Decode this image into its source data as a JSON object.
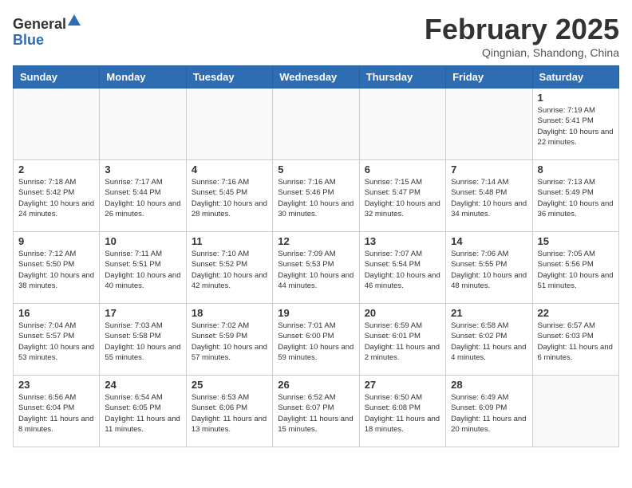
{
  "header": {
    "logo_general": "General",
    "logo_blue": "Blue",
    "month_title": "February 2025",
    "location": "Qingnian, Shandong, China"
  },
  "weekdays": [
    "Sunday",
    "Monday",
    "Tuesday",
    "Wednesday",
    "Thursday",
    "Friday",
    "Saturday"
  ],
  "weeks": [
    [
      {
        "day": "",
        "info": ""
      },
      {
        "day": "",
        "info": ""
      },
      {
        "day": "",
        "info": ""
      },
      {
        "day": "",
        "info": ""
      },
      {
        "day": "",
        "info": ""
      },
      {
        "day": "",
        "info": ""
      },
      {
        "day": "1",
        "info": "Sunrise: 7:19 AM\nSunset: 5:41 PM\nDaylight: 10 hours\nand 22 minutes."
      }
    ],
    [
      {
        "day": "2",
        "info": "Sunrise: 7:18 AM\nSunset: 5:42 PM\nDaylight: 10 hours\nand 24 minutes."
      },
      {
        "day": "3",
        "info": "Sunrise: 7:17 AM\nSunset: 5:44 PM\nDaylight: 10 hours\nand 26 minutes."
      },
      {
        "day": "4",
        "info": "Sunrise: 7:16 AM\nSunset: 5:45 PM\nDaylight: 10 hours\nand 28 minutes."
      },
      {
        "day": "5",
        "info": "Sunrise: 7:16 AM\nSunset: 5:46 PM\nDaylight: 10 hours\nand 30 minutes."
      },
      {
        "day": "6",
        "info": "Sunrise: 7:15 AM\nSunset: 5:47 PM\nDaylight: 10 hours\nand 32 minutes."
      },
      {
        "day": "7",
        "info": "Sunrise: 7:14 AM\nSunset: 5:48 PM\nDaylight: 10 hours\nand 34 minutes."
      },
      {
        "day": "8",
        "info": "Sunrise: 7:13 AM\nSunset: 5:49 PM\nDaylight: 10 hours\nand 36 minutes."
      }
    ],
    [
      {
        "day": "9",
        "info": "Sunrise: 7:12 AM\nSunset: 5:50 PM\nDaylight: 10 hours\nand 38 minutes."
      },
      {
        "day": "10",
        "info": "Sunrise: 7:11 AM\nSunset: 5:51 PM\nDaylight: 10 hours\nand 40 minutes."
      },
      {
        "day": "11",
        "info": "Sunrise: 7:10 AM\nSunset: 5:52 PM\nDaylight: 10 hours\nand 42 minutes."
      },
      {
        "day": "12",
        "info": "Sunrise: 7:09 AM\nSunset: 5:53 PM\nDaylight: 10 hours\nand 44 minutes."
      },
      {
        "day": "13",
        "info": "Sunrise: 7:07 AM\nSunset: 5:54 PM\nDaylight: 10 hours\nand 46 minutes."
      },
      {
        "day": "14",
        "info": "Sunrise: 7:06 AM\nSunset: 5:55 PM\nDaylight: 10 hours\nand 48 minutes."
      },
      {
        "day": "15",
        "info": "Sunrise: 7:05 AM\nSunset: 5:56 PM\nDaylight: 10 hours\nand 51 minutes."
      }
    ],
    [
      {
        "day": "16",
        "info": "Sunrise: 7:04 AM\nSunset: 5:57 PM\nDaylight: 10 hours\nand 53 minutes."
      },
      {
        "day": "17",
        "info": "Sunrise: 7:03 AM\nSunset: 5:58 PM\nDaylight: 10 hours\nand 55 minutes."
      },
      {
        "day": "18",
        "info": "Sunrise: 7:02 AM\nSunset: 5:59 PM\nDaylight: 10 hours\nand 57 minutes."
      },
      {
        "day": "19",
        "info": "Sunrise: 7:01 AM\nSunset: 6:00 PM\nDaylight: 10 hours\nand 59 minutes."
      },
      {
        "day": "20",
        "info": "Sunrise: 6:59 AM\nSunset: 6:01 PM\nDaylight: 11 hours\nand 2 minutes."
      },
      {
        "day": "21",
        "info": "Sunrise: 6:58 AM\nSunset: 6:02 PM\nDaylight: 11 hours\nand 4 minutes."
      },
      {
        "day": "22",
        "info": "Sunrise: 6:57 AM\nSunset: 6:03 PM\nDaylight: 11 hours\nand 6 minutes."
      }
    ],
    [
      {
        "day": "23",
        "info": "Sunrise: 6:56 AM\nSunset: 6:04 PM\nDaylight: 11 hours\nand 8 minutes."
      },
      {
        "day": "24",
        "info": "Sunrise: 6:54 AM\nSunset: 6:05 PM\nDaylight: 11 hours\nand 11 minutes."
      },
      {
        "day": "25",
        "info": "Sunrise: 6:53 AM\nSunset: 6:06 PM\nDaylight: 11 hours\nand 13 minutes."
      },
      {
        "day": "26",
        "info": "Sunrise: 6:52 AM\nSunset: 6:07 PM\nDaylight: 11 hours\nand 15 minutes."
      },
      {
        "day": "27",
        "info": "Sunrise: 6:50 AM\nSunset: 6:08 PM\nDaylight: 11 hours\nand 18 minutes."
      },
      {
        "day": "28",
        "info": "Sunrise: 6:49 AM\nSunset: 6:09 PM\nDaylight: 11 hours\nand 20 minutes."
      },
      {
        "day": "",
        "info": ""
      }
    ]
  ]
}
